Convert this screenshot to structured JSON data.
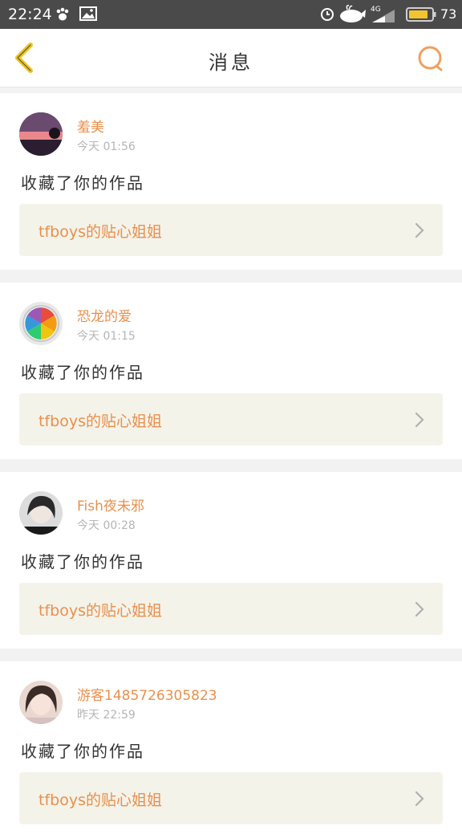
{
  "status_bar": {
    "time": "22:24",
    "network": "4G",
    "battery": "73",
    "icons": [
      "paw-icon",
      "image-icon",
      "alarm-icon",
      "whale-icon",
      "signal-icon",
      "battery-icon"
    ]
  },
  "nav": {
    "title": "消息",
    "back_icon": "chevron-left-icon",
    "search_icon": "search-icon"
  },
  "colors": {
    "accent": "#e8904c",
    "nav_back": "#f0c419",
    "status_bar_bg": "#4a4a4a",
    "work_bg": "#f4f3ea"
  },
  "messages": [
    {
      "username": "羞美",
      "time": "今天 01:56",
      "action": "收藏了你的作品",
      "work_title": "tfboys的贴心姐姐"
    },
    {
      "username": "恐龙的爱",
      "time": "今天 01:15",
      "action": "收藏了你的作品",
      "work_title": "tfboys的贴心姐姐"
    },
    {
      "username": "Fish夜未邪",
      "time": "今天 00:28",
      "action": "收藏了你的作品",
      "work_title": "tfboys的贴心姐姐"
    },
    {
      "username": "游客1485726305823",
      "time": "昨天 22:59",
      "action": "收藏了你的作品",
      "work_title": "tfboys的贴心姐姐"
    }
  ]
}
